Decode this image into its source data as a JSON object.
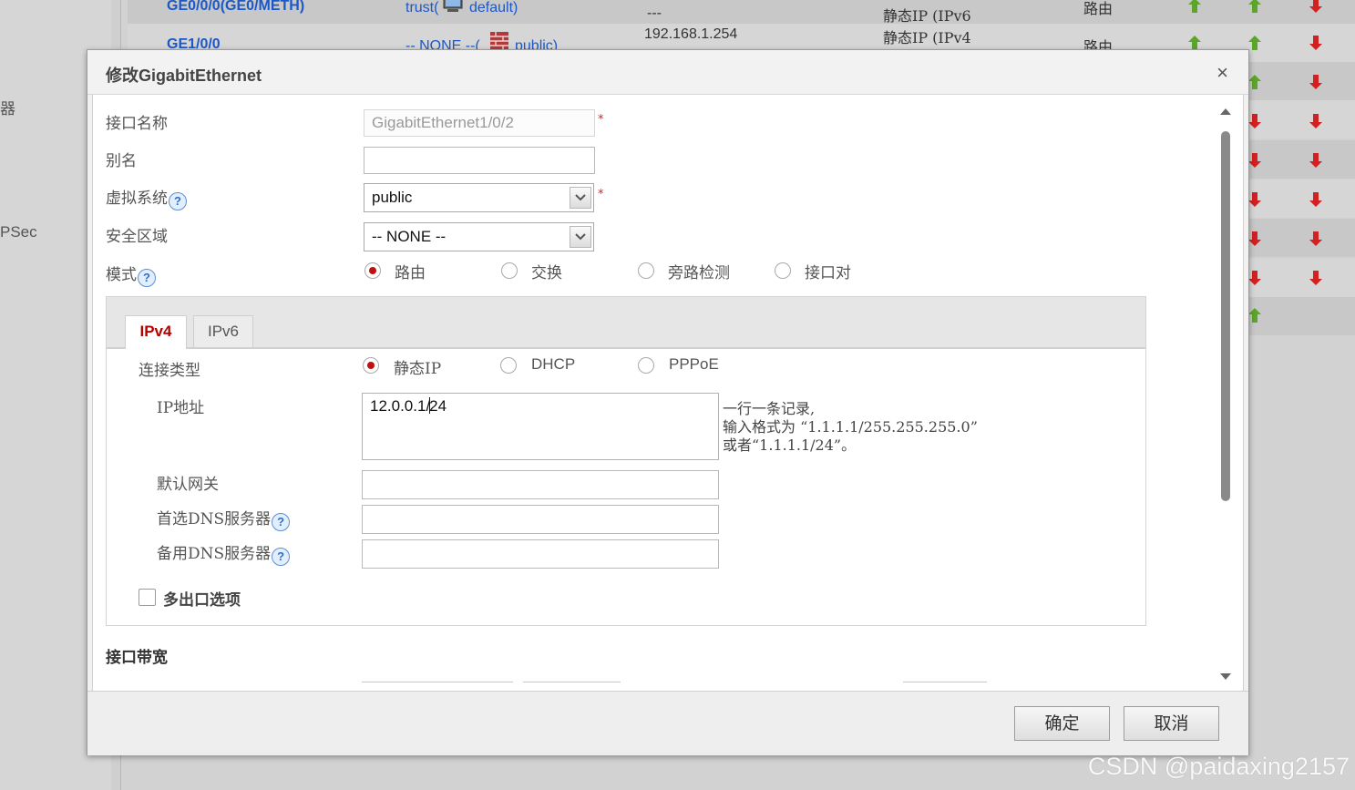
{
  "background": {
    "side_texts": [
      "器",
      "PSec"
    ],
    "rows": [
      {
        "name": "GE0/0/0(GE0/METH)",
        "zone": "trust(",
        "vsys": "default)",
        "ip": "---",
        "type": "静态IP (IPv6",
        "mode": "路由"
      },
      {
        "name": "GE1/0/0",
        "zone": "-- NONE --(",
        "vsys": "public)",
        "ip": "192.168.1.254",
        "type": "静态IP (IPv4",
        "mode": "路由"
      }
    ]
  },
  "dialog": {
    "title": "修改GigabitEthernet",
    "close_label": "×",
    "fields": {
      "name_label": "接口名称",
      "name_value": "GigabitEthernet1/0/2",
      "alias_label": "别名",
      "alias_value": "",
      "vsys_label": "虚拟系统",
      "vsys_value": "public",
      "zone_label": "安全区域",
      "zone_value": "-- NONE --",
      "mode_label": "模式",
      "required_mark": "*"
    },
    "mode_options": [
      {
        "label": "路由",
        "selected": true
      },
      {
        "label": "交换",
        "selected": false
      },
      {
        "label": "旁路检测",
        "selected": false
      },
      {
        "label": "接口对",
        "selected": false
      }
    ],
    "tabs": [
      {
        "label": "IPv4",
        "active": true
      },
      {
        "label": "IPv6",
        "active": false
      }
    ],
    "ipv4": {
      "conn_type_label": "连接类型",
      "conn_options": [
        {
          "label": "静态IP",
          "selected": true
        },
        {
          "label": "DHCP",
          "selected": false
        },
        {
          "label": "PPPoE",
          "selected": false
        }
      ],
      "ip_label": "IP地址",
      "ip_value_before_caret": "12.0.0.1/",
      "ip_value_after_caret": "24",
      "hint_line1": "一行一条记录,",
      "hint_line2": "输入格式为 “1.1.1.1/255.255.255.0”",
      "hint_line3": "或者“1.1.1.1/24”。",
      "gateway_label": "默认网关",
      "gateway_value": "",
      "dns1_label": "首选DNS服务器",
      "dns1_value": "",
      "dns2_label": "备用DNS服务器",
      "dns2_value": "",
      "multi_exit_label": "多出口选项"
    },
    "bandwidth_label": "接口带宽",
    "help_icon_glyph": "?",
    "buttons": {
      "ok": "确定",
      "cancel": "取消"
    }
  },
  "watermark": "CSDN @paidaxing2157",
  "colors": {
    "link_blue": "#1b58c9",
    "radio_selected": "#c21010",
    "active_tab_text": "#b50000",
    "arrow_green": "#5aa52a",
    "arrow_red": "#d42020"
  }
}
